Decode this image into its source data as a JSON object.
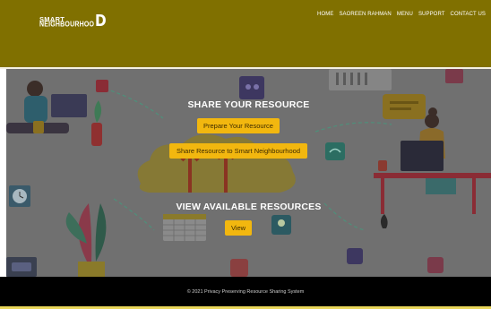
{
  "logo": {
    "line1": "SMART",
    "line2": "NEIGHBOURHOO",
    "last_letter": "D"
  },
  "nav": {
    "items": [
      "HOME",
      "SAOREEN RAHMAN",
      "MENU",
      "SUPPORT",
      "CONTACT US"
    ]
  },
  "hero": {
    "share_title": "SHARE YOUR RESOURCE",
    "prepare_button": "Prepare Your Resource",
    "share_button": "Share Resource to Smart Neighbourhood",
    "view_title": "VIEW AVAILABLE RESOURCES",
    "view_button": "View"
  },
  "footer": {
    "copyright": "© 2021 Privacy Preserving Resource Sharing System"
  },
  "colors": {
    "header": "#807000",
    "button": "#f2b70f",
    "footer": "#000000",
    "footer_accent": "#e9d65a"
  }
}
